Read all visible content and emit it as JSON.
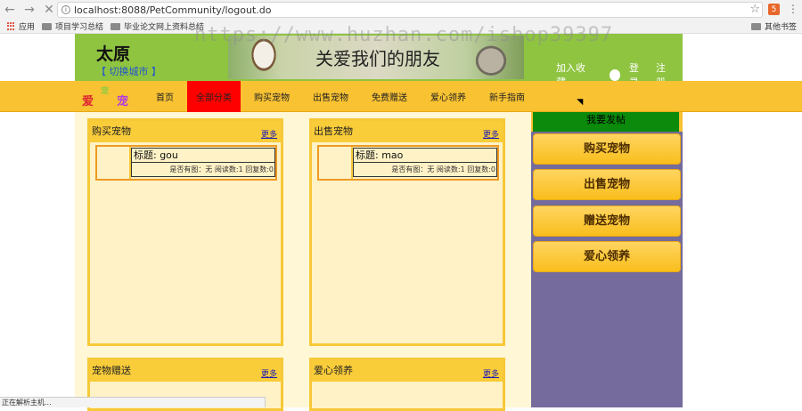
{
  "browser": {
    "url": "localhost:8088/PetCommunity/logout.do",
    "bookmarks": [
      "应用",
      "项目学习总结",
      "毕业论文网上资料总结"
    ],
    "other_bookmarks": "其他书签",
    "status_text": "正在解析主机..."
  },
  "watermark": "https://www.huzhan.com/ishop39397",
  "header": {
    "city": "太原",
    "switch_city": "【 切换城市 】",
    "banner_text": "关爱我们的朋友",
    "add_favorite": "加入收藏",
    "login": "登录",
    "register": "注册"
  },
  "logo": {
    "a": "爱",
    "b": "宠",
    "c": "宠"
  },
  "nav": [
    "首页",
    "全部分类",
    "购买宠物",
    "出售宠物",
    "免费赠送",
    "爱心领养",
    "新手指南"
  ],
  "panels": [
    {
      "title": "购买宠物",
      "more": "更多",
      "post_title": "标题: gou",
      "post_meta": "是否有图：无 阅读数:1 回复数:0"
    },
    {
      "title": "出售宠物",
      "more": "更多",
      "post_title": "标题: mao",
      "post_meta": "是否有图：无 阅读数:1 回复数:0"
    },
    {
      "title": "宠物赠送",
      "more": "更多"
    },
    {
      "title": "爱心领养",
      "more": "更多"
    }
  ],
  "sidebar": {
    "post_button": "我要发帖",
    "buttons": [
      "购买宠物",
      "出售宠物",
      "赠送宠物",
      "爱心领养"
    ]
  },
  "colors": {
    "header_green": "#8fc441",
    "nav_yellow": "#f8c232",
    "active_red": "#ff0000",
    "sidebar_purple": "#756b9c"
  }
}
